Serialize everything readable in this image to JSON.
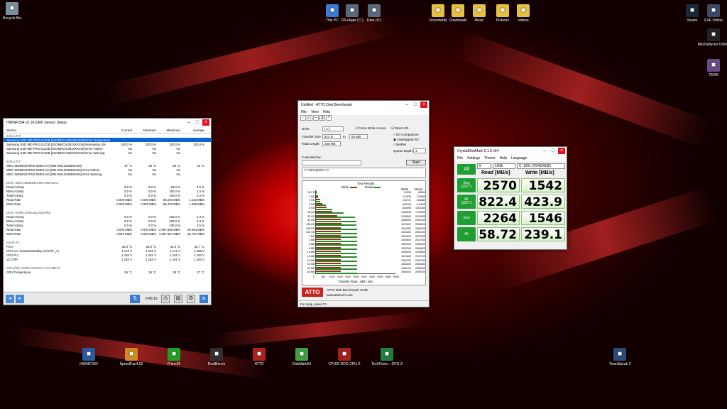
{
  "desktop_icons": [
    {
      "label": "Recycle Bin",
      "icon": "recycle-bin-icon",
      "color": "#7a8ea0"
    },
    {
      "label": "This PC",
      "icon": "computer-icon",
      "color": "#3a7bd5"
    },
    {
      "label": "OS+Apps (C:)",
      "icon": "drive-icon",
      "color": "#5a6a7a"
    },
    {
      "label": "Data (D:)",
      "icon": "drive-icon",
      "color": "#5a6a7a"
    },
    {
      "label": "Documents",
      "icon": "folder-icon",
      "color": "#e8c040"
    },
    {
      "label": "Downloads",
      "icon": "folder-icon",
      "color": "#e8c040"
    },
    {
      "label": "Music",
      "icon": "folder-icon",
      "color": "#e8c040"
    },
    {
      "label": "Pictures",
      "icon": "folder-icon",
      "color": "#e8c040"
    },
    {
      "label": "Videos",
      "icon": "folder-icon",
      "color": "#e8c040"
    },
    {
      "label": "Steam",
      "icon": "steam-icon",
      "color": "#1b2838"
    },
    {
      "label": "EVE Online",
      "icon": "eve-icon",
      "color": "#3a4a6a"
    },
    {
      "label": "MechWarrior Online",
      "icon": "mwo-icon",
      "color": "#222222"
    },
    {
      "label": "TERA",
      "icon": "tera-icon",
      "color": "#6a4a8a"
    },
    {
      "label": "HWiNFO64",
      "icon": "hwinfo-icon",
      "color": "#2a5aa0"
    },
    {
      "label": "SpeedFan4.52",
      "icon": "fan-icon",
      "color": "#d08a20"
    },
    {
      "label": "Prime95",
      "icon": "prime-icon",
      "color": "#20a020"
    },
    {
      "label": "RealBench",
      "icon": "realbench-icon",
      "color": "#303030"
    },
    {
      "label": "ATTO",
      "icon": "atto-icon",
      "color": "#b02020"
    },
    {
      "label": "DiskMark64",
      "icon": "diskmark-icon",
      "color": "#40a040"
    },
    {
      "label": "CPUID ROG CPU-Z",
      "icon": "cpuz-icon",
      "color": "#a02020"
    },
    {
      "label": "TechPowe... GPU-Z",
      "icon": "gpuz-icon",
      "color": "#208040"
    },
    {
      "label": "TeamSpeak 3",
      "icon": "teamspeak-icon",
      "color": "#2a4a7a"
    }
  ],
  "hwinfo": {
    "title": "HWiNFO64 v5.10-2300 Sensor Status",
    "columns": [
      "Sensor",
      "Current",
      "Minimum",
      "Maximum",
      "Average"
    ],
    "rows": [
      {
        "g": true,
        "c": [
          "S.M.A.R.T.",
          "",
          "",
          "",
          ""
        ]
      },
      {
        "sel": true,
        "c": [
          "Samsung SSD 950 PRO 512GB [S2GMNCAGB10XXXW] Drive Temperature",
          "",
          "",
          "",
          ""
        ]
      },
      {
        "c": [
          "Samsung SSD 950 PRO 512GB [S2GMNCAGB10XXXW] Remaining Life",
          "100.0 %",
          "100.0 %",
          "100.0 %",
          "100.0 %"
        ]
      },
      {
        "c": [
          "Samsung SSD 950 PRO 512GB [S2GMNCAGB10XXXW] Drive Failure",
          "No",
          "No",
          "No",
          ""
        ]
      },
      {
        "c": [
          "Samsung SSD 950 PRO 512GB [S2GMNCAGB10XXXW] Drive Warning",
          "No",
          "No",
          "No",
          ""
        ]
      },
      {
        "g": true,
        "c": [
          "",
          "",
          "",
          "",
          ""
        ]
      },
      {
        "g": true,
        "c": [
          "S.M.A.R.T.",
          "",
          "",
          "",
          ""
        ]
      },
      {
        "c": [
          "WDC WD5001FZWX-00ZHUA0 [WD-WX11D35D0HK6]",
          "47 °C",
          "26 °C",
          "48 °C",
          "46 °C"
        ]
      },
      {
        "c": [
          "WDC WD5001FZWX-00ZHUA0 [WD-WX11D35D0HK6] Drive Failure",
          "No",
          "No",
          "No",
          ""
        ]
      },
      {
        "c": [
          "WDC WD5001FZWX-00ZHUA0 [WD-WX11D35D0HK6] Drive Warning",
          "No",
          "No",
          "No",
          ""
        ]
      },
      {
        "g": true,
        "c": [
          "",
          "",
          "",
          "",
          ""
        ]
      },
      {
        "g": true,
        "c": [
          "Drive: WDC WD5001FZWX-00ZHUA0",
          "",
          "",
          "",
          ""
        ]
      },
      {
        "c": [
          "Read Activity",
          "0.0 %",
          "0.0 %",
          "93.2 %",
          "3.5 %"
        ]
      },
      {
        "c": [
          "Write Activity",
          "0.0 %",
          "0.0 %",
          "100.0 %",
          "1.5 %"
        ]
      },
      {
        "c": [
          "Total Activity",
          "0.0 %",
          "0.0 %",
          "100.0 %",
          "4.0 %"
        ]
      },
      {
        "c": [
          "Read Rate",
          "0.000 MB/s",
          "0.000 MB/s",
          "86.220 MB/s",
          "1.442 MB/s"
        ]
      },
      {
        "c": [
          "Write Rate",
          "0.000 MB/s",
          "0.000 MB/s",
          "86.220 MB/s",
          "1.456 MB/s"
        ]
      },
      {
        "g": true,
        "c": [
          "",
          "",
          "",
          "",
          ""
        ]
      },
      {
        "g": true,
        "c": [
          "Drive: NVMe Samsung SSD 950",
          "",
          "",
          "",
          ""
        ]
      },
      {
        "c": [
          "Read Activity",
          "0.0 %",
          "0.0 %",
          "100.0 %",
          "2.3 %"
        ]
      },
      {
        "c": [
          "Write Activity",
          "0.0 %",
          "0.0 %",
          "100.0 %",
          "3.3 %"
        ]
      },
      {
        "c": [
          "Total Activity",
          "0.0 %",
          "0.0 %",
          "100.0 %",
          "4.5 %"
        ]
      },
      {
        "c": [
          "Read Rate",
          "0.000 MB/s",
          "0.000 MB/s",
          "2,597.859 MB/s",
          "29.464 MB/s"
        ]
      },
      {
        "c": [
          "Write Rate",
          "0.813 MB/s",
          "0.000 MB/s",
          "1,597.957 MB/s",
          "15.797 MB/s"
        ]
      },
      {
        "g": true,
        "c": [
          "",
          "",
          "",
          "",
          ""
        ]
      },
      {
        "g": true,
        "c": [
          "ASUS EC",
          "",
          "",
          "",
          ""
        ]
      },
      {
        "c": [
          "PCH",
          "30.0 °C",
          "28.0 °C",
          "34.0 °C",
          "32.7 °C"
        ]
      },
      {
        "c": [
          "CPU Vcc Sustain/Standby (VCCST_A)",
          "1.172 V",
          "1.163 V",
          "1.172 V",
          "1.169 V"
        ]
      },
      {
        "c": [
          "CPU PLL",
          "1.183 V",
          "1.181 V",
          "1.191 V",
          "1.183 V"
        ]
      },
      {
        "c": [
          "VCCPIP",
          "1.183 V",
          "1.163 V",
          "1.191 V",
          "1.183 V"
        ]
      },
      {
        "g": true,
        "c": [
          "",
          "",
          "",
          "",
          ""
        ]
      },
      {
        "g": true,
        "c": [
          "GPU [#0]: NVIDIA GeForce GTX 980 Ti",
          "",
          "",
          "",
          ""
        ]
      },
      {
        "c": [
          "GPU Temperature",
          "26 °C",
          "26 °C",
          "28 °C",
          "27 °C"
        ]
      }
    ],
    "footer_time": "0:45:15"
  },
  "atto": {
    "title": "Untitled - ATTO Disk Benchmark",
    "menu": [
      "File",
      "View",
      "Help"
    ],
    "drive_label": "Drive:",
    "drive_value": "[-c-]",
    "force_write": "Force Write Access",
    "direct_io": "Direct I/O",
    "transfer_label": "Transfer Size:",
    "transfer_from": "512 B",
    "to": "to",
    "transfer_to": "64 MB",
    "length_label": "Total Length:",
    "length_value": "256 MB",
    "io_comparison": "I/O Comparison",
    "overlapped_io": "Overlapped I/O",
    "neither": "Neither",
    "queue_label": "Queue Depth:",
    "queue_value": "4",
    "controlled_label": "Controlled by:",
    "start": "Start",
    "description": "<< Description >>",
    "test_results": "Test Results",
    "write_legend": "Write",
    "read_legend": "Read",
    "col_write": "Write",
    "col_read": "Read",
    "x_axis_title": "Transfer Rate - MB / Sec",
    "x_ticks": [
      "0",
      "500",
      "1000",
      "1500",
      "2000",
      "2500",
      "3000",
      "3500",
      "4000",
      "4500",
      "5000"
    ],
    "logo": "ATTO",
    "footer_title": "ATTO Disk Benchmark v3.05",
    "footer_url": "www.attotech.com",
    "status": "For Help, press F1"
  },
  "chart_data": {
    "type": "bar",
    "categories": [
      "512 B",
      "1 KB",
      "2 KB",
      "4 KB",
      "8 KB",
      "16 KB",
      "32 KB",
      "64 KB",
      "128 KB",
      "256 KB",
      "512 KB",
      "1 MB",
      "2 MB",
      "4 MB",
      "8 MB",
      "12 MB",
      "16 MB",
      "24 MB",
      "32 MB",
      "48 MB",
      "64 MB"
    ],
    "series": [
      {
        "name": "Write",
        "color": "#8b3a1e",
        "values": [
          61.036,
          121.636,
          244.774,
          409.146,
          664.994,
          1006.8,
          1328.5,
          1555.9,
          1571.5,
          1544.3,
          1551.6,
          1554.0,
          1550.8,
          1552.3,
          1552.2,
          1554.4,
          1541.6,
          1554.7,
          1551.6,
          1546.7,
          1564.0
        ]
      },
      {
        "name": "Read",
        "color": "#2a8a2a",
        "values": [
          60.56,
          132.86,
          284.682,
          611.62,
          1001.26,
          1730.9,
          2424.5,
          2532.4,
          2525.6,
          2564.3,
          2552.4,
          2557.5,
          2547.4,
          2556.1,
          2569.8,
          2539.8,
          2547.1,
          2552.3,
          2552.8,
          2555.5,
          2559.7
        ]
      }
    ],
    "write_values_text": [
      "61036",
      "121636",
      "244774",
      "409146",
      "664994",
      "1006800",
      "1328500",
      "1555900",
      "1571500",
      "1544300",
      "1551600",
      "1554000",
      "1550800",
      "1552300",
      "1552200",
      "1554400",
      "1541600",
      "1554700",
      "1551600",
      "1546700",
      "1564000"
    ],
    "read_values_text": [
      "60560",
      "132860",
      "284682",
      "611620",
      "1001260",
      "1730900",
      "2424500",
      "2532400",
      "2525600",
      "2564300",
      "2552400",
      "2557500",
      "2547400",
      "2556100",
      "2569800",
      "2539800",
      "2547100",
      "2552300",
      "2552800",
      "2555500",
      "2559700"
    ],
    "xlim": [
      0,
      5000
    ],
    "xlabel": "Transfer Rate - MB / Sec"
  },
  "cdm": {
    "title": "CrystalDiskMark 5.1.0 x64",
    "menu": [
      "File",
      "Settings",
      "Theme",
      "Help",
      "Language"
    ],
    "all": "All",
    "count": "5",
    "size": "1GiB",
    "drive": "C: 18% (76/429GiB)",
    "read_header": "Read [MB/s]",
    "write_header": "Write [MB/s]",
    "tests": [
      {
        "label": "Seq\nQ32T1",
        "read": "2570",
        "write": "1542"
      },
      {
        "label": "4K\nQ32T1",
        "read": "822.4",
        "write": "423.9"
      },
      {
        "label": "Seq",
        "read": "2264",
        "write": "1546"
      },
      {
        "label": "4K",
        "read": "58.72",
        "write": "239.1"
      }
    ]
  }
}
